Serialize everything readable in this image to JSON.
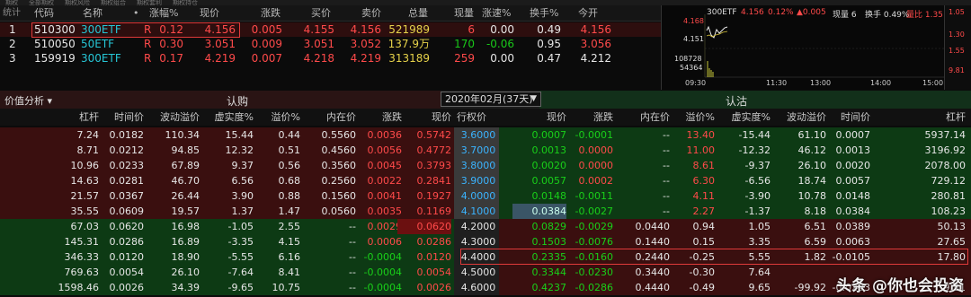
{
  "menu": [
    "期权",
    "全部期权",
    "期权风险",
    "期权组合",
    "期权套利",
    "期权持仓"
  ],
  "quote": {
    "headers": [
      "代码",
      "名称",
      "•",
      "涨幅%",
      "现价",
      "涨跌",
      "买价",
      "卖价",
      "总量",
      "现量",
      "涨速%",
      "换手%",
      "今开"
    ],
    "corner": "统计",
    "rows": [
      {
        "idx": "1",
        "code": "510300",
        "name": "300ETF",
        "tag": "R",
        "chg_pct": "0.12",
        "price": "4.156",
        "chg": "0.005",
        "bid": "4.155",
        "ask": "4.156",
        "vol": "521989",
        "cur": "6",
        "speed": "0.00",
        "turnover": "0.49",
        "open": "4.156"
      },
      {
        "idx": "2",
        "code": "510050",
        "name": "50ETF",
        "tag": "R",
        "chg_pct": "0.30",
        "price": "3.051",
        "chg": "0.009",
        "bid": "3.051",
        "ask": "3.052",
        "vol": "137.9万",
        "cur": "170",
        "speed": "-0.06",
        "turnover": "0.95",
        "open": "3.056"
      },
      {
        "idx": "3",
        "code": "159919",
        "name": "300ETF",
        "tag": "R",
        "chg_pct": "0.17",
        "price": "4.219",
        "chg": "0.007",
        "bid": "4.218",
        "ask": "4.219",
        "vol": "313189",
        "cur": "259",
        "speed": "0.00",
        "turnover": "0.47",
        "open": "4.212"
      }
    ]
  },
  "mini_chart": {
    "name": "300ETF",
    "price": "4.156",
    "pct": "0.12%",
    "change": "▲0.005",
    "now_vol": "现量 6",
    "turnover": "换手 0.49%",
    "extra": "量比 1.35",
    "y_labels": [
      "4.168",
      "4.151"
    ],
    "vol_labels": [
      "108728",
      "54364"
    ],
    "x_labels": [
      "09:30",
      "11:30",
      "13:00",
      "14:00",
      "15:00"
    ],
    "side_labels": [
      "1.05",
      "1.30",
      "1.55",
      "9.81"
    ]
  },
  "options": {
    "panel_label": "价值分析 ▾",
    "call_label": "认购",
    "put_label": "认沽",
    "expiry": "2020年02月(37天)",
    "call_headers": [
      "杠杆",
      "时间价",
      "波动溢价",
      "虚实度%",
      "溢价%",
      "内在价",
      "涨跌",
      "现价"
    ],
    "strike_header": "行权价",
    "put_headers": [
      "现价",
      "涨跌",
      "内在价",
      "溢价%",
      "虚实度%",
      "波动溢价",
      "时间价",
      "杠杆"
    ],
    "rows": [
      {
        "call": [
          "7.24",
          "0.0182",
          "110.34",
          "15.44",
          "0.44",
          "0.5560",
          "0.0036",
          "0.5742"
        ],
        "strike": "3.6000",
        "put": [
          "0.0007",
          "-0.0001",
          "--",
          "13.40",
          "-15.44",
          "61.10",
          "0.0007",
          "5937.14"
        ]
      },
      {
        "call": [
          "8.71",
          "0.0212",
          "94.85",
          "12.32",
          "0.51",
          "0.4560",
          "0.0056",
          "0.4772"
        ],
        "strike": "3.7000",
        "put": [
          "0.0013",
          "0.0000",
          "--",
          "11.00",
          "-12.32",
          "46.12",
          "0.0013",
          "3196.92"
        ]
      },
      {
        "call": [
          "10.96",
          "0.0233",
          "67.89",
          "9.37",
          "0.56",
          "0.3560",
          "0.0045",
          "0.3793"
        ],
        "strike": "3.8000",
        "put": [
          "0.0020",
          "0.0000",
          "--",
          "8.61",
          "-9.37",
          "26.10",
          "0.0020",
          "2078.00"
        ]
      },
      {
        "call": [
          "14.63",
          "0.0281",
          "46.70",
          "6.56",
          "0.68",
          "0.2560",
          "0.0022",
          "0.2841"
        ],
        "strike": "3.9000",
        "put": [
          "0.0057",
          "0.0002",
          "--",
          "6.30",
          "-6.56",
          "18.74",
          "0.0057",
          "729.12"
        ]
      },
      {
        "call": [
          "21.57",
          "0.0367",
          "26.44",
          "3.90",
          "0.88",
          "0.1560",
          "0.0041",
          "0.1927"
        ],
        "strike": "4.0000",
        "put": [
          "0.0148",
          "-0.0011",
          "--",
          "4.11",
          "-3.90",
          "10.78",
          "0.0148",
          "280.81"
        ]
      },
      {
        "call": [
          "35.55",
          "0.0609",
          "19.57",
          "1.37",
          "1.47",
          "0.0560",
          "0.0035",
          "0.1169"
        ],
        "strike": "4.1000",
        "put": [
          "0.0384",
          "-0.0027",
          "--",
          "2.27",
          "-1.37",
          "8.18",
          "0.0384",
          "108.23"
        ]
      },
      {
        "call": [
          "67.03",
          "0.0620",
          "16.98",
          "-1.05",
          "2.55",
          "--",
          "0.0029",
          "0.0620"
        ],
        "strike": "4.2000",
        "put": [
          "0.0829",
          "-0.0029",
          "0.0440",
          "0.94",
          "1.05",
          "6.51",
          "0.0389",
          "50.13"
        ]
      },
      {
        "call": [
          "145.31",
          "0.0286",
          "16.89",
          "-3.35",
          "4.15",
          "--",
          "0.0006",
          "0.0286"
        ],
        "strike": "4.3000",
        "put": [
          "0.1503",
          "-0.0076",
          "0.1440",
          "0.15",
          "3.35",
          "6.59",
          "0.0063",
          "27.65"
        ]
      },
      {
        "call": [
          "346.33",
          "0.0120",
          "18.90",
          "-5.55",
          "6.16",
          "--",
          "-0.0004",
          "0.0120"
        ],
        "strike": "4.4000",
        "put": [
          "0.2335",
          "-0.0160",
          "0.2440",
          "-0.25",
          "5.55",
          "1.82",
          "-0.0105",
          "17.80"
        ]
      },
      {
        "call": [
          "769.63",
          "0.0054",
          "26.10",
          "-7.64",
          "8.41",
          "--",
          "-0.0004",
          "0.0054"
        ],
        "strike": "4.5000",
        "put": [
          "0.3344",
          "-0.0230",
          "0.3440",
          "-0.30",
          "7.64",
          "",
          "",
          ""
        ]
      },
      {
        "call": [
          "1598.46",
          "0.0026",
          "34.39",
          "-9.65",
          "10.75",
          "--",
          "-0.0004",
          "0.0026"
        ],
        "strike": "4.6000",
        "put": [
          "0.4237",
          "-0.0286",
          "0.4440",
          "-0.49",
          "9.65",
          "-99.92",
          "-0.0203",
          "9.81"
        ]
      }
    ]
  },
  "watermark": "头条 @你也会投资"
}
